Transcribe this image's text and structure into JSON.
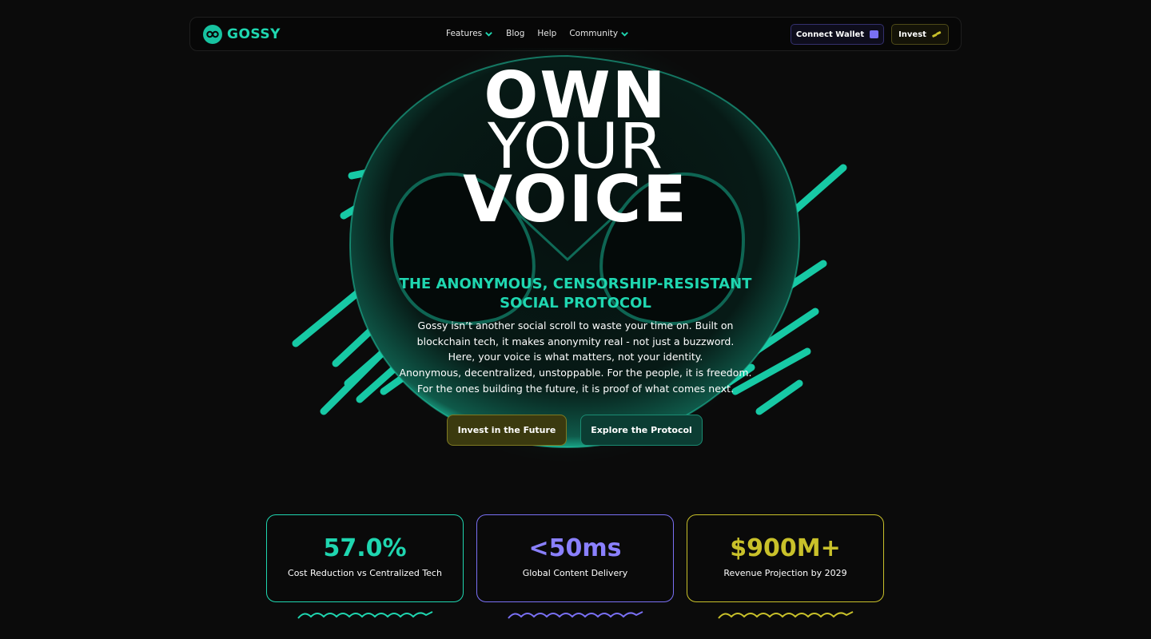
{
  "nav": {
    "logo_text": "GOSSY",
    "links": [
      {
        "label": "Features",
        "has_dropdown": true
      },
      {
        "label": "Blog",
        "has_dropdown": false
      },
      {
        "label": "Help",
        "has_dropdown": false
      },
      {
        "label": "Community",
        "has_dropdown": true
      }
    ],
    "connect_wallet_label": "Connect Wallet",
    "invest_label": "Invest"
  },
  "hero": {
    "headline_line1": "OWN",
    "headline_line2": "YOUR",
    "headline_line3": "VOICE",
    "subheadline_line1": "THE ANONYMOUS, CENSORSHIP-RESISTANT",
    "subheadline_line2": "SOCIAL PROTOCOL",
    "body_lines": [
      "Gossy isn’t another social scroll to waste your time on. Built on",
      "blockchain tech, it makes anonymity real - not just a buzzword.",
      "Here, your voice is what matters, not your identity.",
      "Anonymous, decentralized, unstoppable. For the people, it is freedom.",
      "For the ones building the future, it is proof of what comes next."
    ],
    "cta_invest_label": "Invest in the Future",
    "cta_explore_label": "Explore the Protocol"
  },
  "stats": [
    {
      "value": "57.0%",
      "label": "Cost Reduction vs Centralized Tech",
      "color": "#1fd6b0"
    },
    {
      "value": "<50ms",
      "label": "Global Content Delivery",
      "color": "#8a80ff"
    },
    {
      "value": "$900M+",
      "label": "Revenue Projection by 2029",
      "color": "#c9c12a"
    }
  ],
  "colors": {
    "accent_teal": "#1fd6b0",
    "accent_purple": "#7a70f5",
    "accent_yellow": "#c9c12a",
    "background": "#0b0b0b"
  }
}
